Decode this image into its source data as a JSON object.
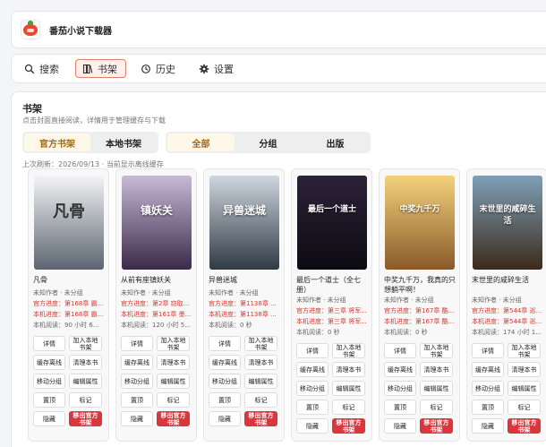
{
  "app": {
    "title": "番茄小说下载器",
    "logo_icon": "tomato-logo-icon"
  },
  "nav": {
    "tabs": [
      {
        "label": "搜索",
        "icon": "search-icon",
        "active": false
      },
      {
        "label": "书架",
        "icon": "bookshelf-icon",
        "active": true
      },
      {
        "label": "历史",
        "icon": "history-icon",
        "active": false
      },
      {
        "label": "设置",
        "icon": "gear-icon",
        "active": false
      }
    ]
  },
  "shelf": {
    "title": "书架",
    "subtitle": "点击封面直接阅读，详情用于管理缓存与下载",
    "source_tabs": [
      {
        "label": "官方书架",
        "active": true
      },
      {
        "label": "本地书架",
        "active": false
      }
    ],
    "filter_tabs": [
      {
        "label": "全部",
        "active": true
      },
      {
        "label": "分组",
        "active": false
      },
      {
        "label": "出版",
        "active": false
      }
    ],
    "refresh_note": "上次刷新：2026/09/13 · 当前显示离线缓存"
  },
  "buttons": {
    "detail": "详情",
    "add_local_1": "加入本地",
    "add_local_2": "书架",
    "cache_offline": "缓存离线",
    "clear_book": "清理本书",
    "move_group": "移动分组",
    "edit_attr": "编辑属性",
    "pin": "置顶",
    "mark": "标记",
    "hide": "隐藏",
    "remove_1": "移出官方",
    "remove_2": "书架"
  },
  "books": [
    {
      "title": "凡骨",
      "author": "未知作者 · 未分组",
      "official": "官方进度：第168章 霸...",
      "local": "本机进度：第168章 霸...",
      "read": "本机阅读：90 小时 6...",
      "cover_text": "凡骨",
      "cover_colors": [
        "#f3f4f6",
        "#5b6470"
      ]
    },
    {
      "title": "从前有座镇妖关",
      "author": "未知作者 · 未分组",
      "official": "官方进度：第2章 窃取...",
      "local": "本机进度：第161章 墨...",
      "read": "本机阅读：120 小时 5...",
      "cover_text": "镇妖关",
      "cover_colors": [
        "#c9b9d8",
        "#3b2a4a"
      ]
    },
    {
      "title": "异兽迷城",
      "author": "未知作者 · 未分组",
      "official": "官方进度：第1138章 ...",
      "local": "本机进度：第1138章 ...",
      "read": "本机阅读：0 秒",
      "cover_text": "异兽迷城",
      "cover_colors": [
        "#cfd6df",
        "#2e3a44"
      ]
    },
    {
      "title": "最后一个道士（全七册）",
      "author": "未知作者 · 未分组",
      "official": "官方进度：第三章 将军...",
      "local": "本机进度：第三章 将军...",
      "read": "本机阅读：0 秒",
      "cover_text": "最后一个道士",
      "cover_colors": [
        "#2c2238",
        "#0d0b12"
      ]
    },
    {
      "title": "中奖九千万，我真的只想躺平啊！",
      "author": "未知作者 · 未分组",
      "official": "官方进度：第167章 酷...",
      "local": "本机进度：第167章 酷...",
      "read": "本机阅读：0 秒",
      "cover_text": "中奖九千万",
      "cover_colors": [
        "#f4d27a",
        "#8a5a2a"
      ]
    },
    {
      "title": "末世里的咸碎生活",
      "author": "未知作者 · 未分组",
      "official": "官方进度：第544章 巡...",
      "local": "本机进度：第544章 巡...",
      "read": "本机阅读：174 小时 1...",
      "cover_text": "末世里的咸碎生活",
      "cover_colors": [
        "#7fa0b8",
        "#3b2a1a"
      ]
    }
  ]
}
